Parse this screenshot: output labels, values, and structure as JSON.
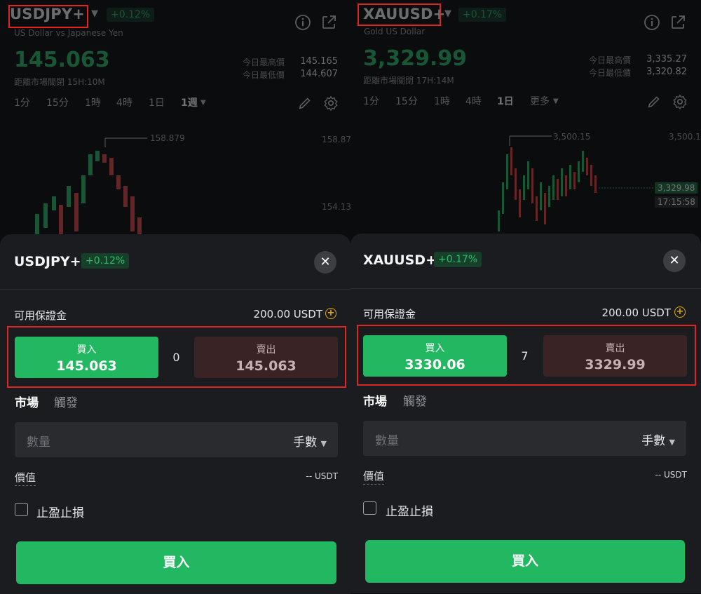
{
  "panels": [
    {
      "symbol": "USDJPY+",
      "change": "+0.12%",
      "description": "US Dollar vs Japanese Yen",
      "price": "145.063",
      "closing_note": "距離市場關閉 15H:10M",
      "high_label": "今日最高價",
      "high_value": "145.165",
      "low_label": "今日最低價",
      "low_value": "144.607",
      "timeframes": [
        "1分",
        "15分",
        "1時",
        "4時",
        "1日",
        "1週"
      ],
      "active_timeframe": "1週",
      "chart": {
        "max_label": "158.879",
        "axis_labels": [
          "158.879",
          "154.136"
        ]
      },
      "sheet": {
        "symbol": "USDJPY+",
        "change": "+0.12%",
        "margin_label": "可用保證金",
        "margin_value": "200.00 USDT",
        "buy_label": "買入",
        "buy_price": "145.063",
        "spread": "0",
        "sell_label": "賣出",
        "sell_price": "145.063",
        "order_tabs": [
          "市場",
          "觸發"
        ],
        "qty_placeholder": "數量",
        "unit": "手數",
        "value_label": "價值",
        "value_value": "-- USDT",
        "tpsl_label": "止盈止損",
        "submit_label": "買入"
      }
    },
    {
      "symbol": "XAUUSD+",
      "change": "+0.17%",
      "description": "Gold US Dollar",
      "price": "3,329.99",
      "closing_note": "距離市場關閉 17H:14M",
      "high_label": "今日最高價",
      "high_value": "3,335.27",
      "low_label": "今日最低價",
      "low_value": "3,320.82",
      "timeframes": [
        "1分",
        "15分",
        "1時",
        "4時",
        "1日",
        "更多"
      ],
      "active_timeframe": "1日",
      "chart": {
        "max_label": "3,500.15",
        "axis_labels": [
          "3,500.15",
          "3,329.98",
          "17:15:58"
        ]
      },
      "sheet": {
        "symbol": "XAUUSD+",
        "change": "+0.17%",
        "margin_label": "可用保證金",
        "margin_value": "200.00 USDT",
        "buy_label": "買入",
        "buy_price": "3330.06",
        "spread": "7",
        "sell_label": "賣出",
        "sell_price": "3329.99",
        "order_tabs": [
          "市場",
          "觸發"
        ],
        "qty_placeholder": "數量",
        "unit": "手數",
        "value_label": "價值",
        "value_value": "-- USDT",
        "tpsl_label": "止盈止損",
        "submit_label": "買入"
      }
    }
  ],
  "colors": {
    "up_green": "#2ebd6b",
    "buy_green": "#22b862",
    "sell_dark": "#3a2324",
    "highlight_red": "#e02424",
    "margin_plus": "#e6a700"
  }
}
